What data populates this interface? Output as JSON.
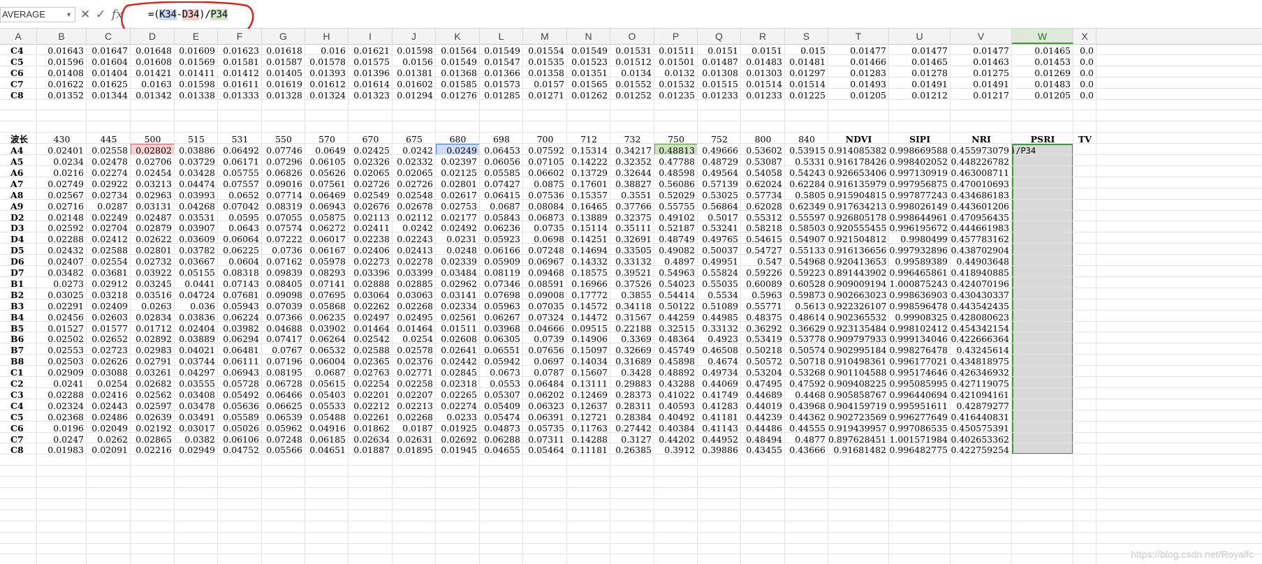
{
  "formula_bar": {
    "name_box": "AVERAGE",
    "cancel_symbol": "✕",
    "enter_symbol": "✓",
    "fx_symbol": "fx",
    "formula": {
      "part1": "=(",
      "ref_k": "K34",
      "part2": "-",
      "ref_d": "D34",
      "part3": ")/",
      "ref_p": "P34"
    }
  },
  "columns": [
    "A",
    "B",
    "C",
    "D",
    "E",
    "F",
    "G",
    "H",
    "I",
    "J",
    "K",
    "L",
    "M",
    "N",
    "O",
    "P",
    "Q",
    "R",
    "S",
    "T",
    "U",
    "V",
    "W",
    "X"
  ],
  "selected_column": "W",
  "top_rows": [
    {
      "label": "C4",
      "values": [
        "0.01643",
        "0.01647",
        "0.01648",
        "0.01609",
        "0.01623",
        "0.01618",
        "0.016",
        "0.01621",
        "0.01598",
        "0.01564",
        "0.01549",
        "0.01554",
        "0.01549",
        "0.01531",
        "0.01511",
        "0.0151",
        "0.0151",
        "0.015",
        "0.01477",
        "0.01477",
        "0.01477",
        "0.01465",
        "0.0"
      ]
    },
    {
      "label": "C5",
      "values": [
        "0.01596",
        "0.01604",
        "0.01608",
        "0.01569",
        "0.01581",
        "0.01587",
        "0.01578",
        "0.01575",
        "0.0156",
        "0.01549",
        "0.01547",
        "0.01535",
        "0.01523",
        "0.01512",
        "0.01501",
        "0.01487",
        "0.01483",
        "0.01481",
        "0.01466",
        "0.01465",
        "0.01463",
        "0.01453",
        "0.0"
      ]
    },
    {
      "label": "C6",
      "values": [
        "0.01408",
        "0.01404",
        "0.01421",
        "0.01411",
        "0.01412",
        "0.01405",
        "0.01393",
        "0.01396",
        "0.01381",
        "0.01368",
        "0.01366",
        "0.01358",
        "0.01351",
        "0.0134",
        "0.0132",
        "0.01308",
        "0.01303",
        "0.01297",
        "0.01283",
        "0.01278",
        "0.01275",
        "0.01269",
        "0.0"
      ]
    },
    {
      "label": "C7",
      "values": [
        "0.01622",
        "0.01625",
        "0.0163",
        "0.01598",
        "0.01611",
        "0.01619",
        "0.01612",
        "0.01614",
        "0.01602",
        "0.01585",
        "0.01573",
        "0.0157",
        "0.01565",
        "0.01552",
        "0.01532",
        "0.01515",
        "0.01514",
        "0.01514",
        "0.01493",
        "0.01491",
        "0.01491",
        "0.01483",
        "0.0"
      ]
    },
    {
      "label": "C8",
      "values": [
        "0.01352",
        "0.01344",
        "0.01342",
        "0.01338",
        "0.01333",
        "0.01328",
        "0.01324",
        "0.01323",
        "0.01294",
        "0.01276",
        "0.01285",
        "0.01271",
        "0.01262",
        "0.01252",
        "0.01235",
        "0.01233",
        "0.01233",
        "0.01225",
        "0.01205",
        "0.01212",
        "0.01217",
        "0.01205",
        "0.0"
      ]
    }
  ],
  "header_row": {
    "label": "波长",
    "wavelengths": [
      "430",
      "445",
      "500",
      "515",
      "531",
      "550",
      "570",
      "670",
      "675",
      "680",
      "698",
      "700",
      "712",
      "732",
      "750",
      "752",
      "800",
      "840"
    ],
    "indices": [
      "NDVI",
      "SIPI",
      "NRI",
      "PSRI",
      "TV"
    ]
  },
  "data_rows": [
    {
      "label": "A4",
      "v": [
        "0.02401",
        "0.02558",
        "0.02802",
        "0.03886",
        "0.06492",
        "0.07746",
        "0.0649",
        "0.02425",
        "0.0242",
        "0.0249",
        "0.06453",
        "0.07592",
        "0.15314",
        "0.34217",
        "0.48813",
        "0.49666",
        "0.53602",
        "0.53915",
        "0.914085382",
        "0.998669588",
        "0.455973079"
      ]
    },
    {
      "label": "A5",
      "v": [
        "0.0234",
        "0.02478",
        "0.02706",
        "0.03729",
        "0.06171",
        "0.07296",
        "0.06105",
        "0.02326",
        "0.02332",
        "0.02397",
        "0.06056",
        "0.07105",
        "0.14222",
        "0.32352",
        "0.47788",
        "0.48729",
        "0.53087",
        "0.5331",
        "0.916178426",
        "0.998402052",
        "0.448226782"
      ]
    },
    {
      "label": "A6",
      "v": [
        "0.0216",
        "0.02274",
        "0.02454",
        "0.03428",
        "0.05755",
        "0.06826",
        "0.05626",
        "0.02065",
        "0.02065",
        "0.02125",
        "0.05585",
        "0.06602",
        "0.13729",
        "0.32644",
        "0.48598",
        "0.49564",
        "0.54058",
        "0.54243",
        "0.926653406",
        "0.997130919",
        "0.463008711"
      ]
    },
    {
      "label": "A7",
      "v": [
        "0.02749",
        "0.02922",
        "0.03213",
        "0.04474",
        "0.07557",
        "0.09016",
        "0.07561",
        "0.02726",
        "0.02726",
        "0.02801",
        "0.07427",
        "0.0875",
        "0.17601",
        "0.38827",
        "0.56086",
        "0.57139",
        "0.62024",
        "0.62284",
        "0.916135979",
        "0.997956875",
        "0.470010693"
      ]
    },
    {
      "label": "A8",
      "v": [
        "0.02567",
        "0.02734",
        "0.02963",
        "0.03993",
        "0.0652",
        "0.07714",
        "0.06469",
        "0.02549",
        "0.02548",
        "0.02617",
        "0.06415",
        "0.07536",
        "0.15357",
        "0.3551",
        "0.52029",
        "0.53025",
        "0.57734",
        "0.5805",
        "0.915904815",
        "0.997877243",
        "0.434686183"
      ]
    },
    {
      "label": "A9",
      "v": [
        "0.02716",
        "0.0287",
        "0.03131",
        "0.04268",
        "0.07042",
        "0.08319",
        "0.06943",
        "0.02676",
        "0.02678",
        "0.02753",
        "0.0687",
        "0.08084",
        "0.16465",
        "0.37766",
        "0.55755",
        "0.56864",
        "0.62028",
        "0.62349",
        "0.917634213",
        "0.998026149",
        "0.443601206"
      ]
    },
    {
      "label": "D2",
      "v": [
        "0.02148",
        "0.02249",
        "0.02487",
        "0.03531",
        "0.0595",
        "0.07055",
        "0.05875",
        "0.02113",
        "0.02112",
        "0.02177",
        "0.05843",
        "0.06873",
        "0.13889",
        "0.32375",
        "0.49102",
        "0.5017",
        "0.55312",
        "0.55597",
        "0.926805178",
        "0.998644961",
        "0.470956435"
      ]
    },
    {
      "label": "D3",
      "v": [
        "0.02592",
        "0.02704",
        "0.02879",
        "0.03907",
        "0.0643",
        "0.07574",
        "0.06272",
        "0.02411",
        "0.0242",
        "0.02492",
        "0.06236",
        "0.0735",
        "0.15114",
        "0.35111",
        "0.52187",
        "0.53241",
        "0.58218",
        "0.58503",
        "0.920555455",
        "0.996195672",
        "0.444661983"
      ]
    },
    {
      "label": "D4",
      "v": [
        "0.02288",
        "0.02412",
        "0.02622",
        "0.03609",
        "0.06064",
        "0.07222",
        "0.06017",
        "0.02238",
        "0.02243",
        "0.0231",
        "0.05923",
        "0.0698",
        "0.14251",
        "0.32691",
        "0.48749",
        "0.49765",
        "0.54615",
        "0.54907",
        "0.921504812",
        "0.9980499",
        "0.457783162"
      ]
    },
    {
      "label": "D5",
      "v": [
        "0.02432",
        "0.02588",
        "0.02801",
        "0.03782",
        "0.06225",
        "0.0736",
        "0.06167",
        "0.02406",
        "0.02413",
        "0.0248",
        "0.06166",
        "0.07248",
        "0.14694",
        "0.33505",
        "0.49082",
        "0.50037",
        "0.54727",
        "0.55133",
        "0.916136656",
        "0.997932896",
        "0.438702904"
      ]
    },
    {
      "label": "D6",
      "v": [
        "0.02407",
        "0.02554",
        "0.02732",
        "0.03667",
        "0.0604",
        "0.07162",
        "0.05978",
        "0.02273",
        "0.02278",
        "0.02339",
        "0.05909",
        "0.06967",
        "0.14332",
        "0.33132",
        "0.4897",
        "0.49951",
        "0.547",
        "0.54968",
        "0.920413653",
        "0.99589389",
        "0.44903648"
      ]
    },
    {
      "label": "D7",
      "v": [
        "0.03482",
        "0.03681",
        "0.03922",
        "0.05155",
        "0.08318",
        "0.09839",
        "0.08293",
        "0.03396",
        "0.03399",
        "0.03484",
        "0.08119",
        "0.09468",
        "0.18575",
        "0.39521",
        "0.54963",
        "0.55824",
        "0.59226",
        "0.59223",
        "0.891443902",
        "0.996465861",
        "0.418940885"
      ]
    },
    {
      "label": "B1",
      "v": [
        "0.0273",
        "0.02912",
        "0.03245",
        "0.0441",
        "0.07143",
        "0.08405",
        "0.07141",
        "0.02888",
        "0.02885",
        "0.02962",
        "0.07346",
        "0.08591",
        "0.16966",
        "0.37526",
        "0.54023",
        "0.55035",
        "0.60089",
        "0.60528",
        "0.909009194",
        "1.000875243",
        "0.424070196"
      ]
    },
    {
      "label": "B2",
      "v": [
        "0.03025",
        "0.03218",
        "0.03516",
        "0.04724",
        "0.07681",
        "0.09098",
        "0.07695",
        "0.03064",
        "0.03063",
        "0.03141",
        "0.07698",
        "0.09008",
        "0.17772",
        "0.3855",
        "0.54414",
        "0.5534",
        "0.5963",
        "0.59873",
        "0.902663023",
        "0.998636903",
        "0.430430337"
      ]
    },
    {
      "label": "B3",
      "v": [
        "0.02291",
        "0.02409",
        "0.0263",
        "0.036",
        "0.05943",
        "0.07039",
        "0.05868",
        "0.02262",
        "0.02268",
        "0.02334",
        "0.05963",
        "0.07035",
        "0.14572",
        "0.34118",
        "0.50122",
        "0.51089",
        "0.55771",
        "0.5613",
        "0.922326107",
        "0.998596478",
        "0.443542435"
      ]
    },
    {
      "label": "B4",
      "v": [
        "0.02456",
        "0.02603",
        "0.02834",
        "0.03836",
        "0.06224",
        "0.07366",
        "0.06235",
        "0.02497",
        "0.02495",
        "0.02561",
        "0.06267",
        "0.07324",
        "0.14472",
        "0.31567",
        "0.44259",
        "0.44985",
        "0.48375",
        "0.48614",
        "0.902365532",
        "0.99908325",
        "0.428080623"
      ]
    },
    {
      "label": "B5",
      "v": [
        "0.01527",
        "0.01577",
        "0.01712",
        "0.02404",
        "0.03982",
        "0.04688",
        "0.03902",
        "0.01464",
        "0.01464",
        "0.01511",
        "0.03968",
        "0.04666",
        "0.09515",
        "0.22188",
        "0.32515",
        "0.33132",
        "0.36292",
        "0.36629",
        "0.923135484",
        "0.998102412",
        "0.454342154"
      ]
    },
    {
      "label": "B6",
      "v": [
        "0.02502",
        "0.02652",
        "0.02892",
        "0.03889",
        "0.06294",
        "0.07417",
        "0.06264",
        "0.02542",
        "0.0254",
        "0.02608",
        "0.06305",
        "0.0739",
        "0.14906",
        "0.3369",
        "0.48364",
        "0.4923",
        "0.53419",
        "0.53778",
        "0.909797933",
        "0.999134046",
        "0.422666364"
      ]
    },
    {
      "label": "B7",
      "v": [
        "0.02553",
        "0.02723",
        "0.02983",
        "0.04021",
        "0.06481",
        "0.0767",
        "0.06532",
        "0.02588",
        "0.02578",
        "0.02641",
        "0.06551",
        "0.07656",
        "0.15097",
        "0.32669",
        "0.45749",
        "0.46508",
        "0.50218",
        "0.50574",
        "0.902995184",
        "0.998276478",
        "0.43245614"
      ]
    },
    {
      "label": "B8",
      "v": [
        "0.02503",
        "0.02626",
        "0.02791",
        "0.03744",
        "0.06111",
        "0.07196",
        "0.06004",
        "0.02365",
        "0.02376",
        "0.02442",
        "0.05942",
        "0.0697",
        "0.14034",
        "0.31689",
        "0.45898",
        "0.4674",
        "0.50572",
        "0.50718",
        "0.910498361",
        "0.996177021",
        "0.434818975"
      ]
    },
    {
      "label": "C1",
      "v": [
        "0.02909",
        "0.03088",
        "0.03261",
        "0.04297",
        "0.06943",
        "0.08195",
        "0.0687",
        "0.02763",
        "0.02771",
        "0.02845",
        "0.0673",
        "0.0787",
        "0.15607",
        "0.3428",
        "0.48892",
        "0.49734",
        "0.53204",
        "0.53268",
        "0.901104588",
        "0.995174646",
        "0.426346932"
      ]
    },
    {
      "label": "C2",
      "v": [
        "0.0241",
        "0.0254",
        "0.02682",
        "0.03555",
        "0.05728",
        "0.06728",
        "0.05615",
        "0.02254",
        "0.02258",
        "0.02318",
        "0.0553",
        "0.06484",
        "0.13111",
        "0.29883",
        "0.43288",
        "0.44069",
        "0.47495",
        "0.47592",
        "0.909408225",
        "0.995085995",
        "0.427119075"
      ]
    },
    {
      "label": "C3",
      "v": [
        "0.02288",
        "0.02416",
        "0.02562",
        "0.03408",
        "0.05492",
        "0.06466",
        "0.05403",
        "0.02201",
        "0.02207",
        "0.02265",
        "0.05307",
        "0.06202",
        "0.12469",
        "0.28373",
        "0.41022",
        "0.41749",
        "0.44689",
        "0.4468",
        "0.905858767",
        "0.996440694",
        "0.421094161"
      ]
    },
    {
      "label": "C4",
      "v": [
        "0.02324",
        "0.02443",
        "0.02597",
        "0.03478",
        "0.05636",
        "0.06625",
        "0.05533",
        "0.02212",
        "0.02213",
        "0.02274",
        "0.05409",
        "0.06323",
        "0.12637",
        "0.28311",
        "0.40593",
        "0.41283",
        "0.44019",
        "0.43968",
        "0.904159719",
        "0.995951611",
        "0.42879277"
      ]
    },
    {
      "label": "C5",
      "v": [
        "0.02368",
        "0.02486",
        "0.02639",
        "0.03491",
        "0.05589",
        "0.06539",
        "0.05488",
        "0.02261",
        "0.02268",
        "0.0233",
        "0.05474",
        "0.06391",
        "0.12721",
        "0.28384",
        "0.40492",
        "0.41181",
        "0.44239",
        "0.44362",
        "0.902723569",
        "0.996277649",
        "0.416440831"
      ]
    },
    {
      "label": "C6",
      "v": [
        "0.0196",
        "0.02049",
        "0.02192",
        "0.03017",
        "0.05026",
        "0.05962",
        "0.04916",
        "0.01862",
        "0.0187",
        "0.01925",
        "0.04873",
        "0.05735",
        "0.11763",
        "0.27442",
        "0.40384",
        "0.41143",
        "0.44486",
        "0.44555",
        "0.919439957",
        "0.997086535",
        "0.450575391"
      ]
    },
    {
      "label": "C7",
      "v": [
        "0.0247",
        "0.0262",
        "0.02865",
        "0.0382",
        "0.06106",
        "0.07248",
        "0.06185",
        "0.02634",
        "0.02631",
        "0.02692",
        "0.06288",
        "0.07311",
        "0.14288",
        "0.3127",
        "0.44202",
        "0.44952",
        "0.48494",
        "0.4877",
        "0.897628451",
        "1.001571984",
        "0.402653362"
      ]
    },
    {
      "label": "C8",
      "v": [
        "0.01983",
        "0.02091",
        "0.02216",
        "0.02949",
        "0.04752",
        "0.05566",
        "0.04651",
        "0.01887",
        "0.01895",
        "0.01945",
        "0.04655",
        "0.05464",
        "0.11181",
        "0.26385",
        "0.3912",
        "0.39886",
        "0.43455",
        "0.43666",
        "0.91681482",
        "0.996482775",
        "0.422759254"
      ]
    }
  ],
  "editing_cell_text": ")/P34",
  "watermark": "https://blog.csdn.net/Royalfc"
}
